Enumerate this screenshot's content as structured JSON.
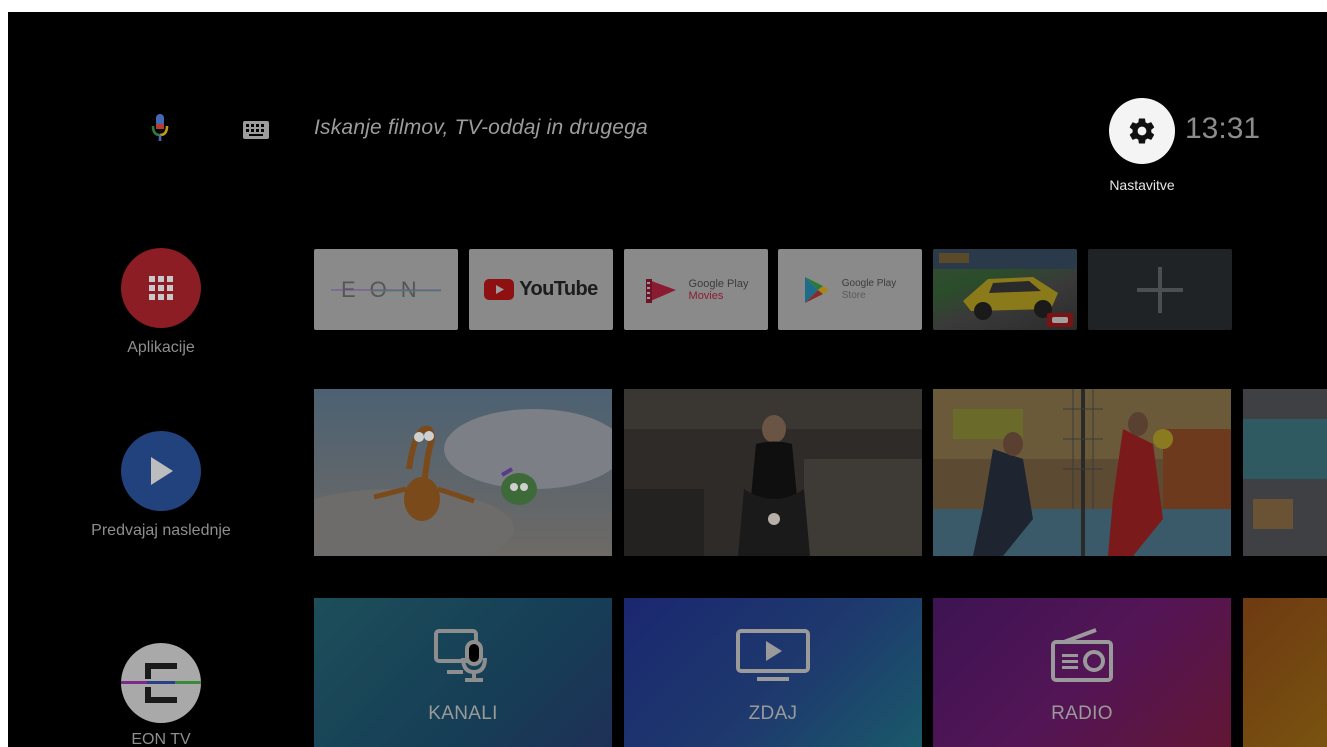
{
  "search": {
    "placeholder": "Iskanje filmov, TV-oddaj in drugega"
  },
  "settings": {
    "label": "Nastavitve"
  },
  "clock": {
    "time": "13:31"
  },
  "rail": {
    "items": [
      {
        "label": "Aplikacije",
        "icon": "apps-grid-icon",
        "color": "#8c1d24"
      },
      {
        "label": "Predvajaj naslednje",
        "icon": "play-icon",
        "color": "#22427e"
      },
      {
        "label": "EON TV",
        "icon": "eon-tv-icon",
        "color": "#a9a9a9"
      }
    ]
  },
  "apps": {
    "eon": "EON",
    "youtube": "YouTube",
    "play_movies_line1": "Google Play",
    "play_movies_line2": "Movies",
    "play_store_line1": "Google Play",
    "play_store_line2": "Store"
  },
  "categories": [
    {
      "label": "KANALI",
      "icon": "channels-icon"
    },
    {
      "label": "ZDAJ",
      "icon": "now-playing-icon"
    },
    {
      "label": "RADIO",
      "icon": "radio-icon"
    }
  ],
  "colors": {
    "background": "#000000",
    "youtube_red": "#8e1010",
    "mic_blue": "#3f63b0"
  }
}
